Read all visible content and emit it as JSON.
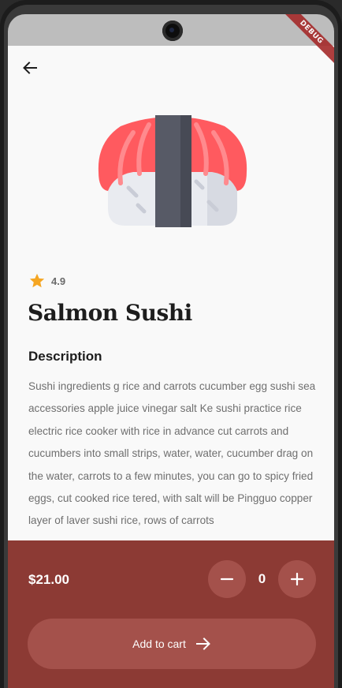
{
  "product": {
    "name": "Salmon Sushi",
    "rating": "4.9",
    "image_icon": "salmon-sushi-illustration"
  },
  "description": {
    "heading": "Description",
    "text": "Sushi ingredients g rice and carrots cucumber egg sushi sea accessories apple juice vinegar salt Ke sushi practice rice electric rice cooker with rice in advance cut carrots and cucumbers into small strips, water, water, cucumber drag on the water, carrots to a few minutes, you can go to spicy fried eggs, cut cooked rice tered, with salt will be Pingguo copper layer of laver sushi rice, rows of carrots"
  },
  "cart": {
    "price": "$21.00",
    "quantity": "0",
    "add_label": "Add to cart"
  },
  "debug_banner": "DEBUG",
  "icons": {
    "back": "arrow-back-icon",
    "star": "star-icon",
    "minus": "minus-icon",
    "plus": "plus-icon",
    "cart_arrow": "arrow-right-icon"
  },
  "colors": {
    "panel": "#8c3a34",
    "panel_button": "#a4514b",
    "star": "#f5a623",
    "salmon": "#ff5a5f",
    "nori": "#575a66",
    "rice": "#e9ebf0"
  }
}
